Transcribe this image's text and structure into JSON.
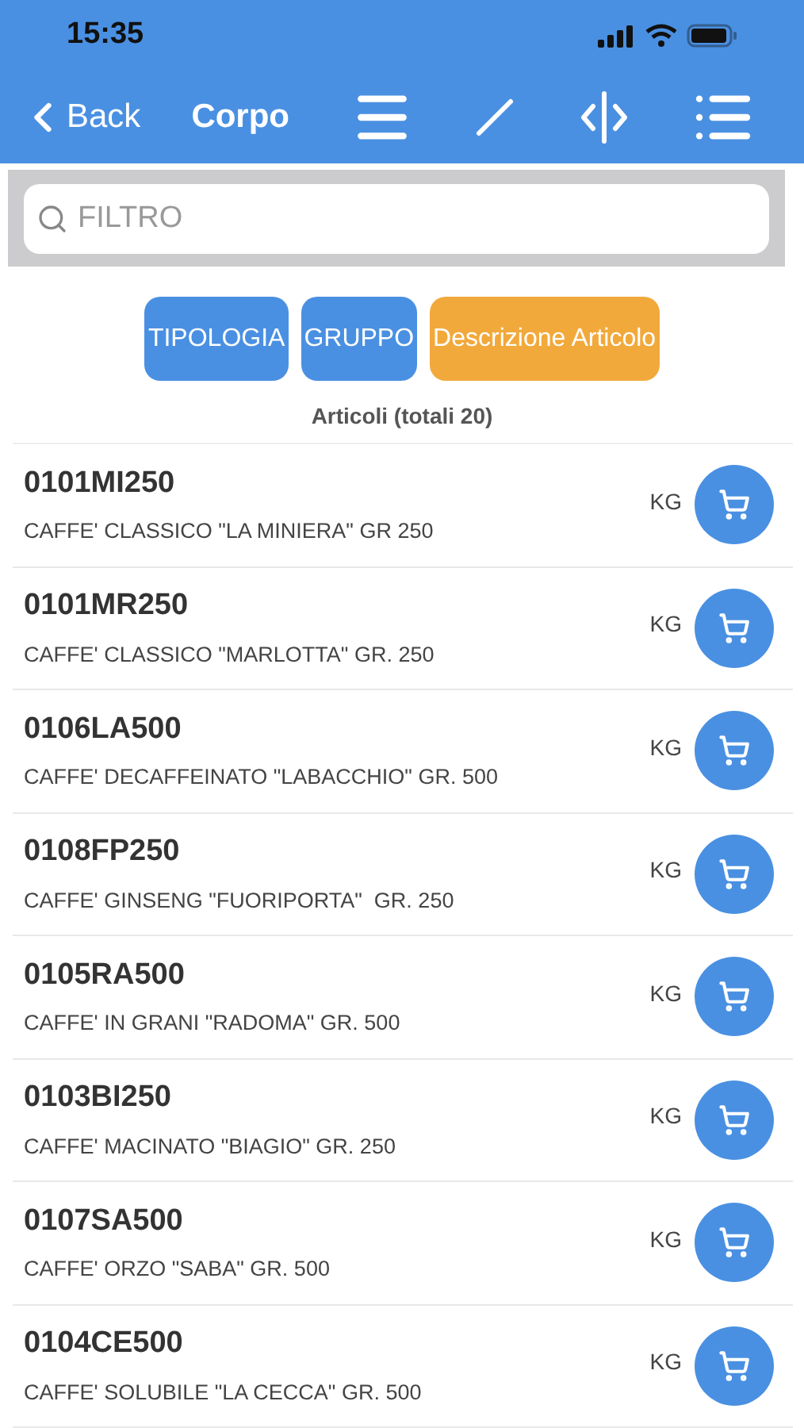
{
  "status_bar": {
    "time": "15:35"
  },
  "nav_bar": {
    "back": "Back",
    "title": "Corpo"
  },
  "filter": {
    "placeholder": "FILTRO"
  },
  "sort_buttons": [
    {
      "label": "TIPOLOGIA",
      "selected": false
    },
    {
      "label": "GRUPPO",
      "selected": false
    },
    {
      "label": "Descrizione Articolo",
      "selected": true
    }
  ],
  "list_title": "Articoli (totali 20)",
  "items": [
    {
      "code": "0101MI250",
      "description": "CAFFE' CLASSICO \"LA MINIERA\" GR 250",
      "unit": "KG"
    },
    {
      "code": "0101MR250",
      "description": "CAFFE' CLASSICO \"MARLOTTA\" GR. 250",
      "unit": "KG"
    },
    {
      "code": "0106LA500",
      "description": "CAFFE' DECAFFEINATO \"LABACCHIO\" GR. 500",
      "unit": "KG"
    },
    {
      "code": "0108FP250",
      "description": "CAFFE' GINSENG \"FUORIPORTA\"  GR. 250",
      "unit": "KG"
    },
    {
      "code": "0105RA500",
      "description": "CAFFE' IN GRANI \"RADOMA\" GR. 500",
      "unit": "KG"
    },
    {
      "code": "0103BI250",
      "description": "CAFFE' MACINATO \"BIAGIO\" GR. 250",
      "unit": "KG"
    },
    {
      "code": "0107SA500",
      "description": "CAFFE' ORZO \"SABA\" GR. 500",
      "unit": "KG"
    },
    {
      "code": "0104CE500",
      "description": "CAFFE' SOLUBILE \"LA CECCA\" GR. 500",
      "unit": "KG"
    }
  ]
}
